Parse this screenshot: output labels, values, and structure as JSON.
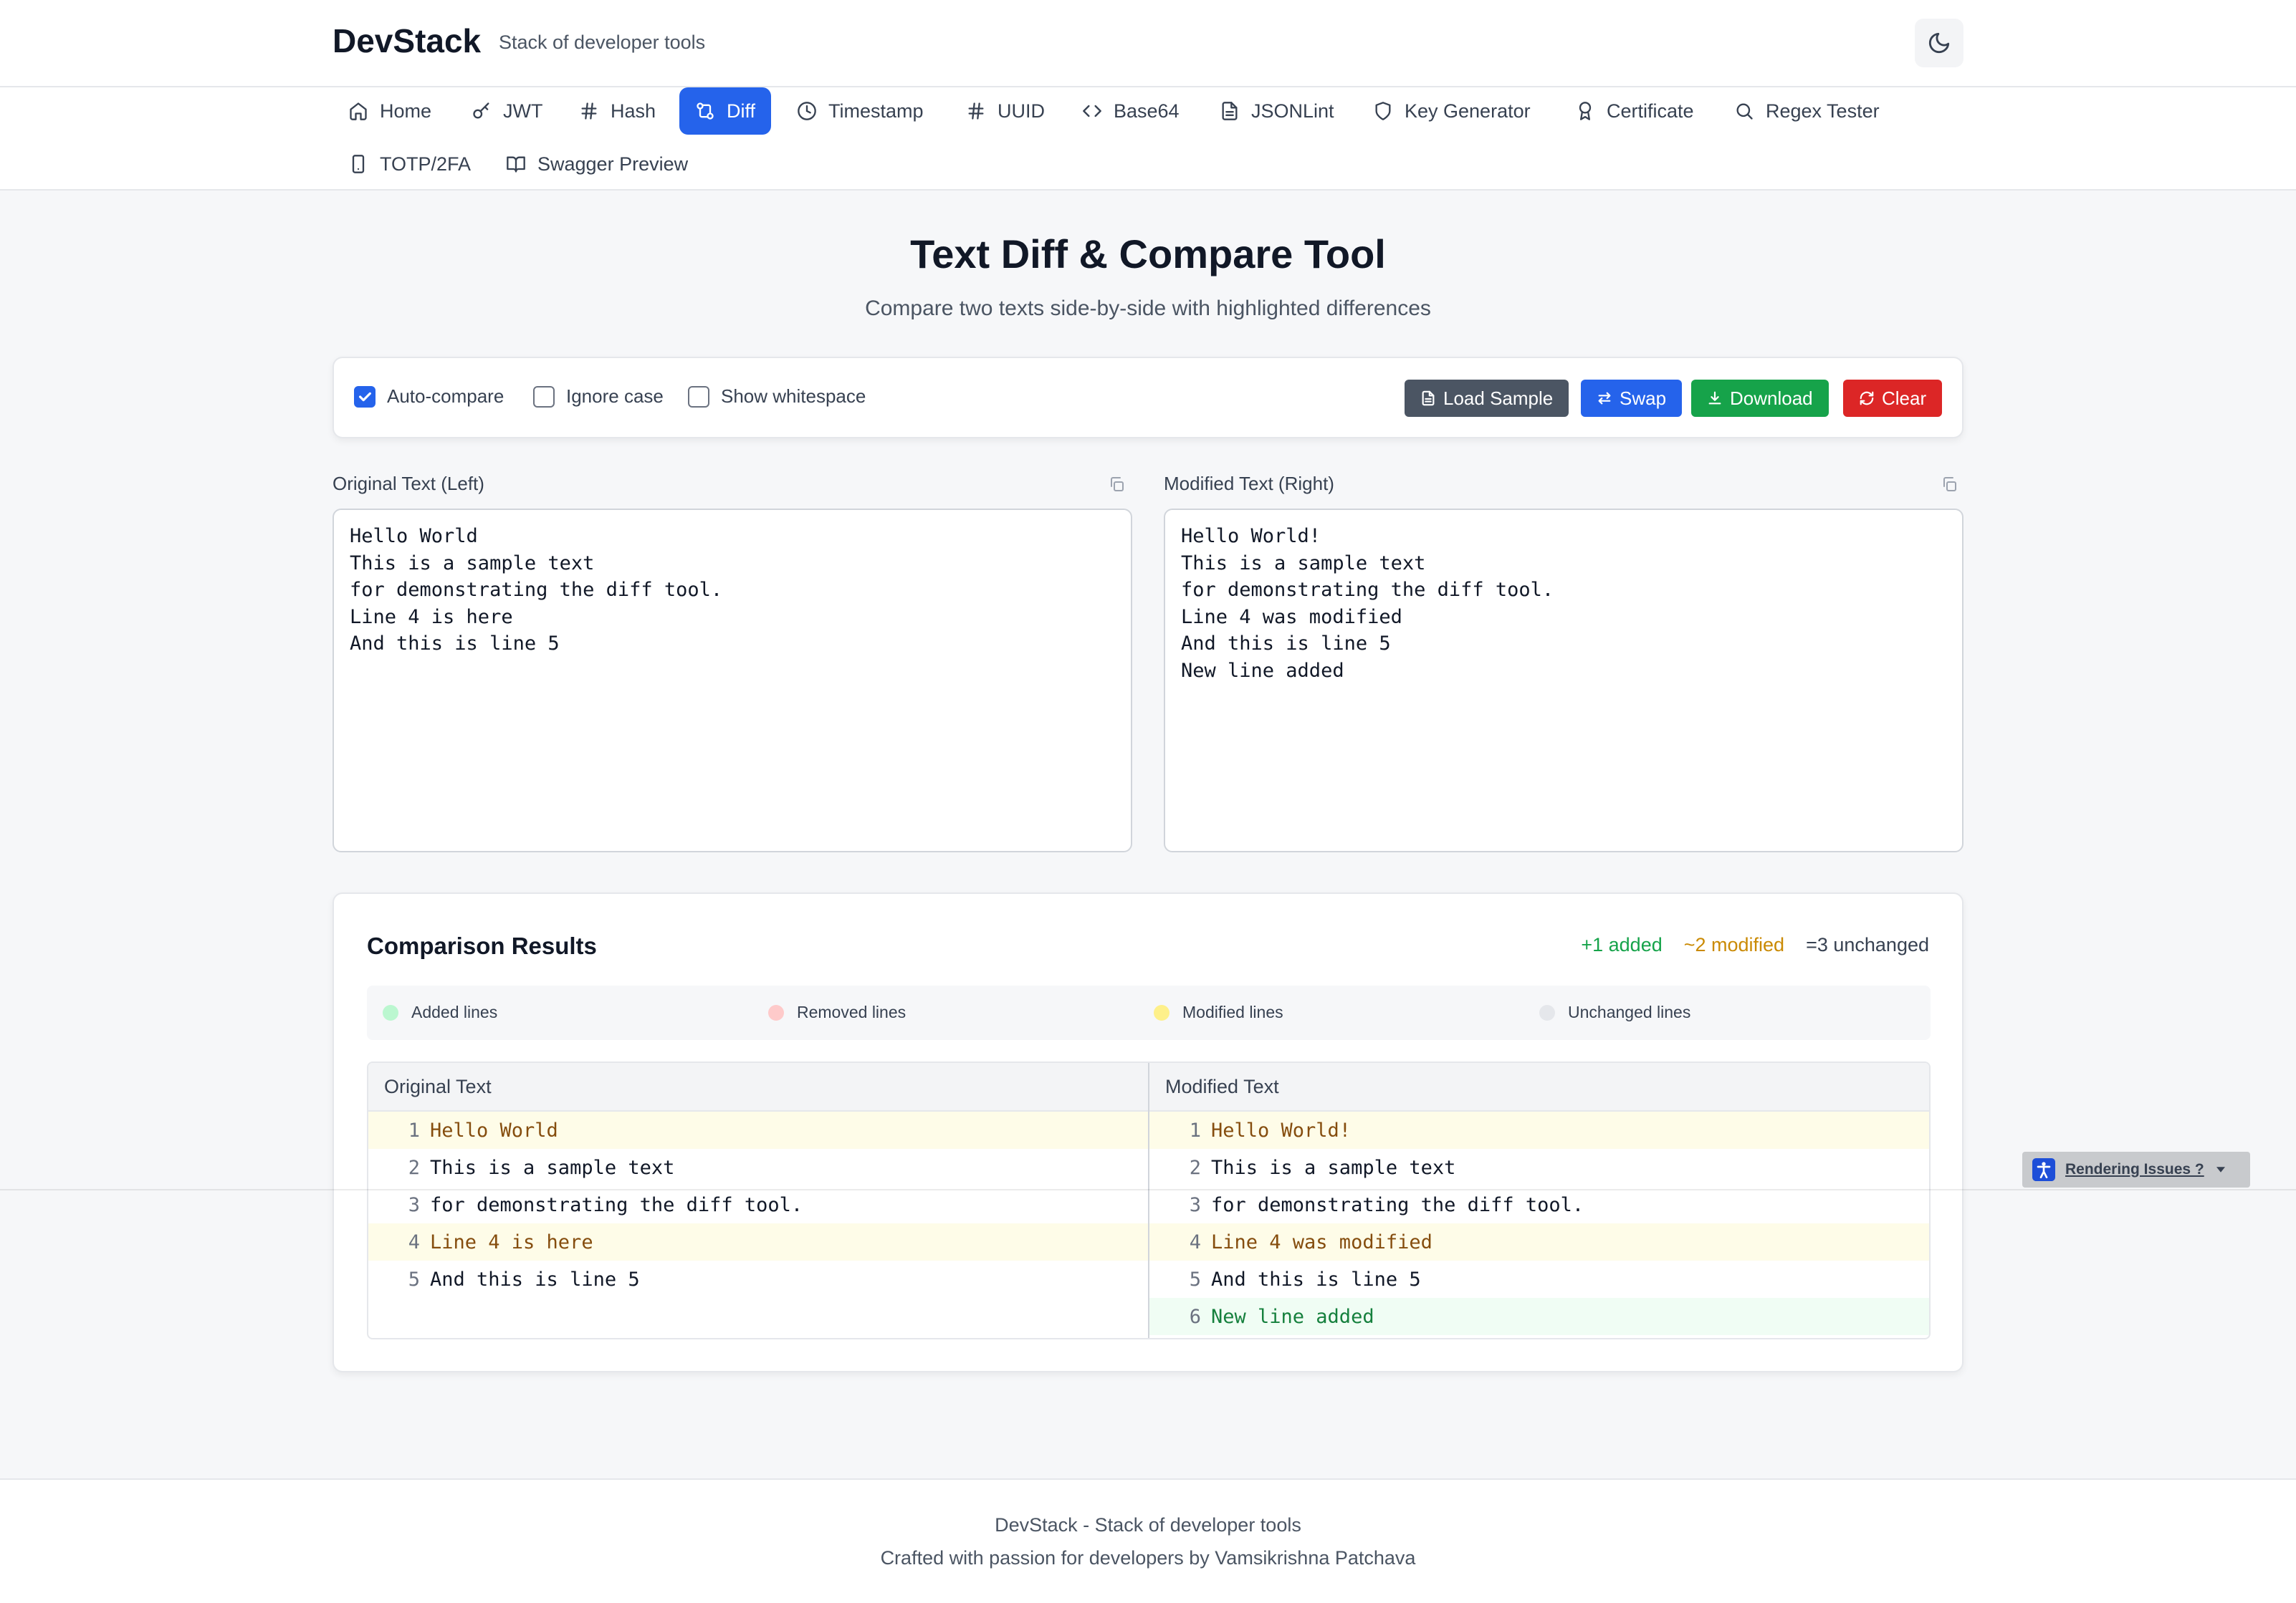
{
  "header": {
    "brand": "DevStack",
    "tagline": "Stack of developer tools",
    "theme_icon": "moon-icon"
  },
  "nav": {
    "items": [
      {
        "label": "Home",
        "icon": "home-icon"
      },
      {
        "label": "JWT",
        "icon": "key-icon"
      },
      {
        "label": "Hash",
        "icon": "hash-icon"
      },
      {
        "label": "Diff",
        "icon": "git-compare-icon",
        "active": true
      },
      {
        "label": "Timestamp",
        "icon": "clock-icon"
      },
      {
        "label": "UUID",
        "icon": "hash-icon"
      },
      {
        "label": "Base64",
        "icon": "code-icon"
      },
      {
        "label": "JSONLint",
        "icon": "file-text-icon"
      },
      {
        "label": "Key Generator",
        "icon": "shield-icon"
      },
      {
        "label": "Certificate",
        "icon": "award-icon"
      },
      {
        "label": "Regex Tester",
        "icon": "search-icon"
      },
      {
        "label": "TOTP/2FA",
        "icon": "smartphone-icon"
      },
      {
        "label": "Swagger Preview",
        "icon": "book-open-icon"
      }
    ]
  },
  "page": {
    "title": "Text Diff & Compare Tool",
    "subtitle": "Compare two texts side-by-side with highlighted differences"
  },
  "options": {
    "auto_compare": {
      "label": "Auto-compare",
      "checked": true
    },
    "ignore_case": {
      "label": "Ignore case",
      "checked": false
    },
    "show_whitespace": {
      "label": "Show whitespace",
      "checked": false
    },
    "buttons": {
      "load_sample": "Load Sample",
      "swap": "Swap",
      "download": "Download",
      "clear": "Clear"
    }
  },
  "editors": {
    "left": {
      "label": "Original Text (Left)",
      "value": "Hello World\nThis is a sample text\nfor demonstrating the diff tool.\nLine 4 is here\nAnd this is line 5"
    },
    "right": {
      "label": "Modified Text (Right)",
      "value": "Hello World!\nThis is a sample text\nfor demonstrating the diff tool.\nLine 4 was modified\nAnd this is line 5\nNew line added"
    }
  },
  "results": {
    "title": "Comparison Results",
    "stats": {
      "added": "+1 added",
      "modified": "~2 modified",
      "unchanged": "=3 unchanged"
    },
    "legend": {
      "added": "Added lines",
      "removed": "Removed lines",
      "modified": "Modified lines",
      "unchanged": "Unchanged lines"
    },
    "left_header": "Original Text",
    "right_header": "Modified Text",
    "left_lines": [
      {
        "num": "1",
        "text": "Hello World",
        "status": "modified"
      },
      {
        "num": "2",
        "text": "This is a sample text",
        "status": "unchanged"
      },
      {
        "num": "3",
        "text": "for demonstrating the diff tool.",
        "status": "unchanged"
      },
      {
        "num": "4",
        "text": "Line 4 is here",
        "status": "modified"
      },
      {
        "num": "5",
        "text": "And this is line 5",
        "status": "unchanged"
      }
    ],
    "right_lines": [
      {
        "num": "1",
        "text": "Hello World!",
        "status": "modified"
      },
      {
        "num": "2",
        "text": "This is a sample text",
        "status": "unchanged"
      },
      {
        "num": "3",
        "text": "for demonstrating the diff tool.",
        "status": "unchanged"
      },
      {
        "num": "4",
        "text": "Line 4 was modified",
        "status": "modified"
      },
      {
        "num": "5",
        "text": "And this is line 5",
        "status": "unchanged"
      },
      {
        "num": "6",
        "text": "New line added",
        "status": "added"
      }
    ]
  },
  "overlay": {
    "rendering_issues": "Rendering Issues ?"
  },
  "footer": {
    "line1": "DevStack - Stack of developer tools",
    "line2": "Crafted with passion for developers by Vamsikrishna Patchava"
  },
  "colors": {
    "accent": "#2563eb",
    "load_sample": "#4b5563",
    "swap": "#2563eb",
    "download": "#16a34a",
    "clear": "#dc2626",
    "added": "#16a34a",
    "modified": "#ca8a04",
    "unchanged": "#374151",
    "legend_added": "#bbf7d0",
    "legend_removed": "#fecaca",
    "legend_modified": "#fef08a",
    "legend_unchanged": "#e5e7eb"
  }
}
